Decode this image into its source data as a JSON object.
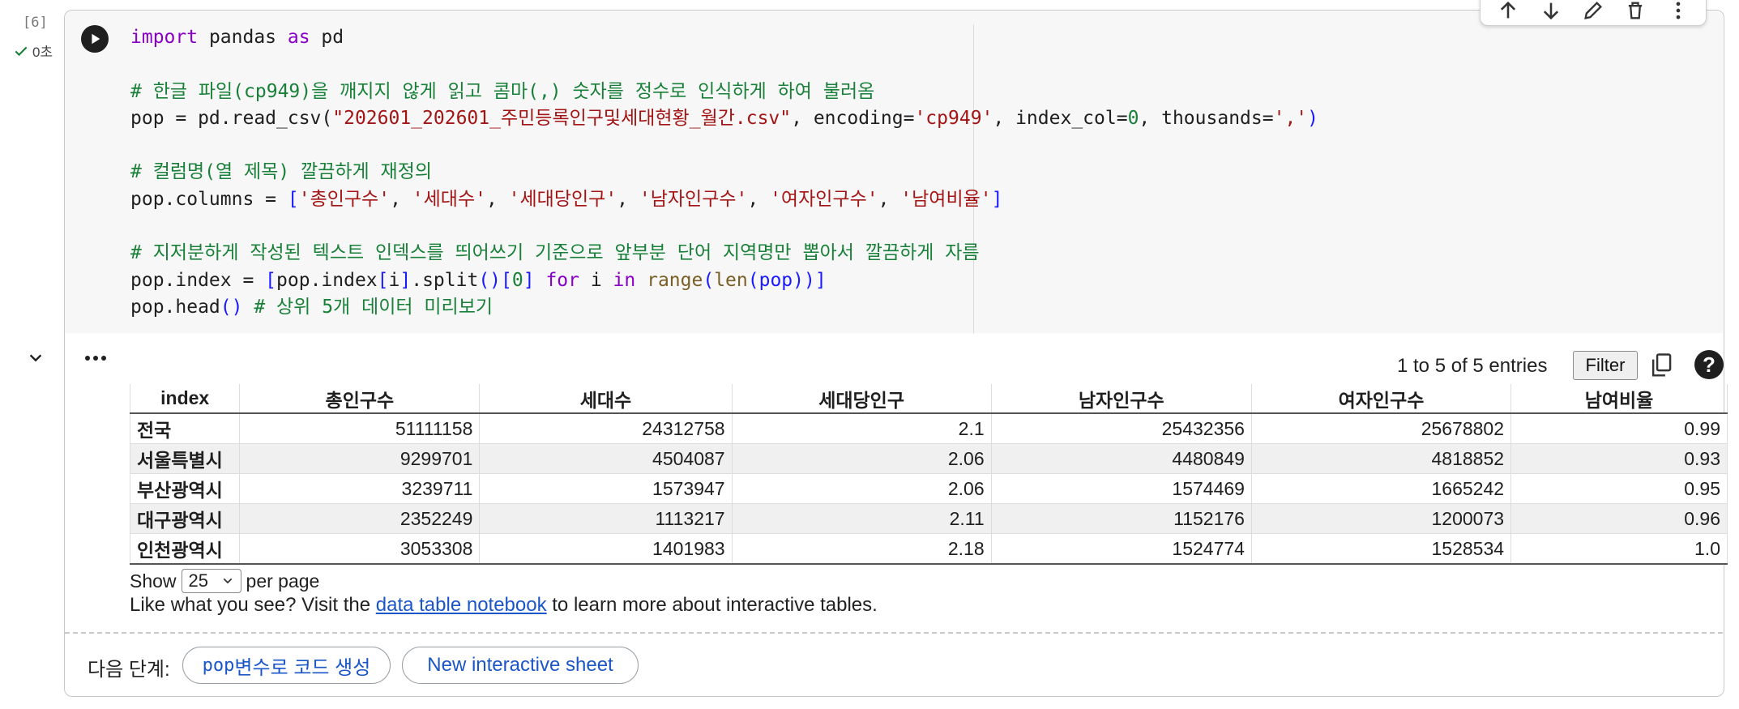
{
  "cell": {
    "execution_count": "[6]",
    "status_time": "0초",
    "code_lines": [
      [
        {
          "t": "import",
          "c": "kw"
        },
        {
          "t": " pandas ",
          "c": ""
        },
        {
          "t": "as",
          "c": "kw"
        },
        {
          "t": " pd",
          "c": ""
        }
      ],
      [],
      [
        {
          "t": "# 한글 파일(cp949)을 깨지지 않게 읽고 콤마(,) 숫자를 정수로 인식하게 하여 불러옴",
          "c": "cm"
        }
      ],
      [
        {
          "t": "pop = pd.read_csv(",
          "c": ""
        },
        {
          "t": "\"202601_202601_주민등록인구및세대현황_월간.csv\"",
          "c": "st"
        },
        {
          "t": ", encoding=",
          "c": ""
        },
        {
          "t": "'cp949'",
          "c": "st"
        },
        {
          "t": ", index_col=",
          "c": ""
        },
        {
          "t": "0",
          "c": "cm"
        },
        {
          "t": ", thousands=",
          "c": ""
        },
        {
          "t": "','",
          "c": "st"
        },
        {
          "t": ")",
          "c": "bl"
        }
      ],
      [],
      [
        {
          "t": "# 컬럼명(열 제목) 깔끔하게 재정의",
          "c": "cm"
        }
      ],
      [
        {
          "t": "pop.columns = ",
          "c": ""
        },
        {
          "t": "[",
          "c": "bl"
        },
        {
          "t": "'총인구수'",
          "c": "st"
        },
        {
          "t": ", ",
          "c": ""
        },
        {
          "t": "'세대수'",
          "c": "st"
        },
        {
          "t": ", ",
          "c": ""
        },
        {
          "t": "'세대당인구'",
          "c": "st"
        },
        {
          "t": ", ",
          "c": ""
        },
        {
          "t": "'남자인구수'",
          "c": "st"
        },
        {
          "t": ", ",
          "c": ""
        },
        {
          "t": "'여자인구수'",
          "c": "st"
        },
        {
          "t": ", ",
          "c": ""
        },
        {
          "t": "'남여비율'",
          "c": "st"
        },
        {
          "t": "]",
          "c": "bl"
        }
      ],
      [],
      [
        {
          "t": "# 지저분하게 작성된 텍스트 인덱스를 띄어쓰기 기준으로 앞부분 단어 지역명만 뽑아서 깔끔하게 자름",
          "c": "cm"
        }
      ],
      [
        {
          "t": "pop.index = ",
          "c": ""
        },
        {
          "t": "[",
          "c": "bl"
        },
        {
          "t": "pop.index",
          "c": ""
        },
        {
          "t": "[",
          "c": "bl"
        },
        {
          "t": "i",
          "c": ""
        },
        {
          "t": "]",
          "c": "bl"
        },
        {
          "t": ".split",
          "c": ""
        },
        {
          "t": "()[",
          "c": "bl"
        },
        {
          "t": "0",
          "c": "cm"
        },
        {
          "t": "] ",
          "c": "bl"
        },
        {
          "t": "for",
          "c": "kw"
        },
        {
          "t": " i ",
          "c": ""
        },
        {
          "t": "in",
          "c": "kw"
        },
        {
          "t": " ",
          "c": ""
        },
        {
          "t": "range",
          "c": "fn"
        },
        {
          "t": "(",
          "c": "bl"
        },
        {
          "t": "len",
          "c": "fn"
        },
        {
          "t": "(pop))]",
          "c": "bl"
        }
      ],
      [
        {
          "t": "pop.head",
          "c": ""
        },
        {
          "t": "()",
          "c": "bl"
        },
        {
          "t": " # 상위 5개 데이터 미리보기",
          "c": "cm"
        }
      ]
    ]
  },
  "output": {
    "entries_text": "1 to 5 of 5 entries",
    "filter_label": "Filter",
    "help_label": "?",
    "table": {
      "columns": [
        "index",
        "총인구수",
        "세대수",
        "세대당인구",
        "남자인구수",
        "여자인구수",
        "남여비율"
      ],
      "rows": [
        [
          "전국",
          "51111158",
          "24312758",
          "2.1",
          "25432356",
          "25678802",
          "0.99"
        ],
        [
          "서울특별시",
          "9299701",
          "4504087",
          "2.06",
          "4480849",
          "4818852",
          "0.93"
        ],
        [
          "부산광역시",
          "3239711",
          "1573947",
          "2.06",
          "1574469",
          "1665242",
          "0.95"
        ],
        [
          "대구광역시",
          "2352249",
          "1113217",
          "2.11",
          "1152176",
          "1200073",
          "0.96"
        ],
        [
          "인천광역시",
          "3053308",
          "1401983",
          "2.18",
          "1524774",
          "1528534",
          "1.0"
        ]
      ]
    },
    "show_label": "Show",
    "per_page_value": "25",
    "per_page_label": "per page",
    "like_prefix": "Like what you see? Visit the ",
    "like_link": "data table notebook",
    "like_suffix": " to learn more about interactive tables."
  },
  "next_steps": {
    "label": "다음 단계:",
    "chip_var": "pop",
    "chip_code_suffix": " 변수로 코드 생성",
    "chip_sheet": "New interactive sheet"
  },
  "colors": {
    "keyword": "#8b00c7",
    "comment": "#188038",
    "string": "#a31515",
    "bracket": "#1a1aff",
    "link": "#1a56c8",
    "success": "#188038"
  }
}
